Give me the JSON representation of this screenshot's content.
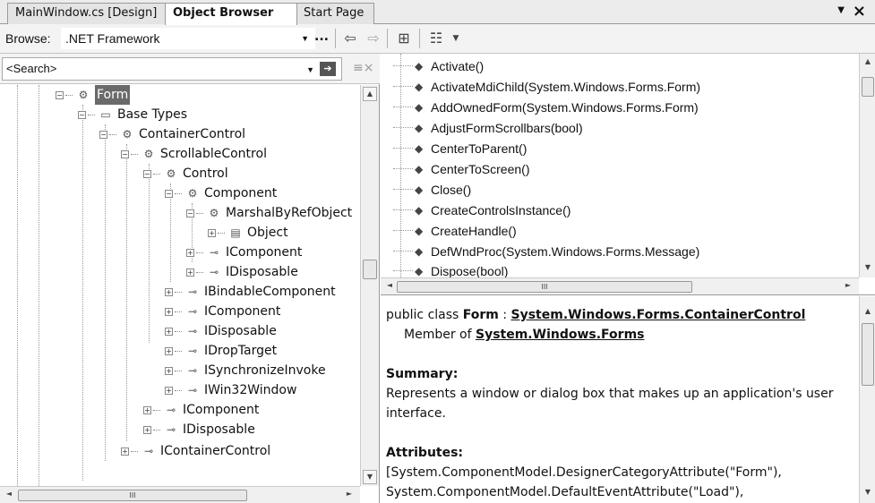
{
  "tabs": [
    {
      "label": "MainWindow.cs [Design]",
      "active": false
    },
    {
      "label": "Object Browser",
      "active": true
    },
    {
      "label": "Start Page",
      "active": false
    }
  ],
  "toolbar": {
    "browse_label": "Browse:",
    "browse_value": ".NET Framework",
    "ellipsis": "..."
  },
  "search": {
    "placeholder": "<Search>"
  },
  "tree": [
    {
      "label": "Form",
      "icon": "class-icon",
      "expander": "−",
      "selected": true
    },
    {
      "label": "Base Types",
      "icon": "folder-icon",
      "expander": "−"
    },
    {
      "label": "ContainerControl",
      "icon": "class-icon",
      "expander": "−"
    },
    {
      "label": "ScrollableControl",
      "icon": "class-icon",
      "expander": "−"
    },
    {
      "label": "Control",
      "icon": "class-icon",
      "expander": "−"
    },
    {
      "label": "Component",
      "icon": "class-icon",
      "expander": "−"
    },
    {
      "label": "MarshalByRefObject",
      "icon": "class-icon",
      "expander": "−"
    },
    {
      "label": "Object",
      "icon": "object-icon",
      "expander": "+"
    },
    {
      "label": "IComponent",
      "icon": "interface-icon",
      "expander": "+"
    },
    {
      "label": "IDisposable",
      "icon": "interface-icon",
      "expander": "+"
    },
    {
      "label": "IBindableComponent",
      "icon": "interface-icon",
      "expander": "+"
    },
    {
      "label": "IComponent",
      "icon": "interface-icon",
      "expander": "+"
    },
    {
      "label": "IDisposable",
      "icon": "interface-icon",
      "expander": "+"
    },
    {
      "label": "IDropTarget",
      "icon": "interface-icon",
      "expander": "+"
    },
    {
      "label": "ISynchronizeInvoke",
      "icon": "interface-icon",
      "expander": "+"
    },
    {
      "label": "IWin32Window",
      "icon": "interface-icon",
      "expander": "+"
    },
    {
      "label": "IComponent",
      "icon": "interface-icon",
      "expander": "+"
    },
    {
      "label": "IDisposable",
      "icon": "interface-icon",
      "expander": "+"
    },
    {
      "label": "IContainerControl",
      "icon": "interface-icon",
      "expander": "+"
    }
  ],
  "members": [
    "Activate()",
    "ActivateMdiChild(System.Windows.Forms.Form)",
    "AddOwnedForm(System.Windows.Forms.Form)",
    "AdjustFormScrollbars(bool)",
    "CenterToParent()",
    "CenterToScreen()",
    "Close()",
    "CreateControlsInstance()",
    "CreateHandle()",
    "DefWndProc(System.Windows.Forms.Message)",
    "Dispose(bool)"
  ],
  "description": {
    "decl_prefix": "public class ",
    "decl_name": "Form",
    "decl_sep": " : ",
    "base_link": "System.Windows.Forms.ContainerControl",
    "member_of_prefix": "Member of ",
    "namespace_link": "System.Windows.Forms",
    "summary_heading": "Summary:",
    "summary_text": "Represents a window or dialog box that makes up an application's user interface.",
    "attributes_heading": "Attributes:",
    "attribute_1": "[System.ComponentModel.DesignerCategoryAttribute(\"Form\"),",
    "attribute_2": "System.ComponentModel.DefaultEventAttribute(\"Load\"),"
  },
  "scroll_glyphs": {
    "up": "▲",
    "down": "▼",
    "left": "◄",
    "right": "►",
    "grip": "III"
  }
}
